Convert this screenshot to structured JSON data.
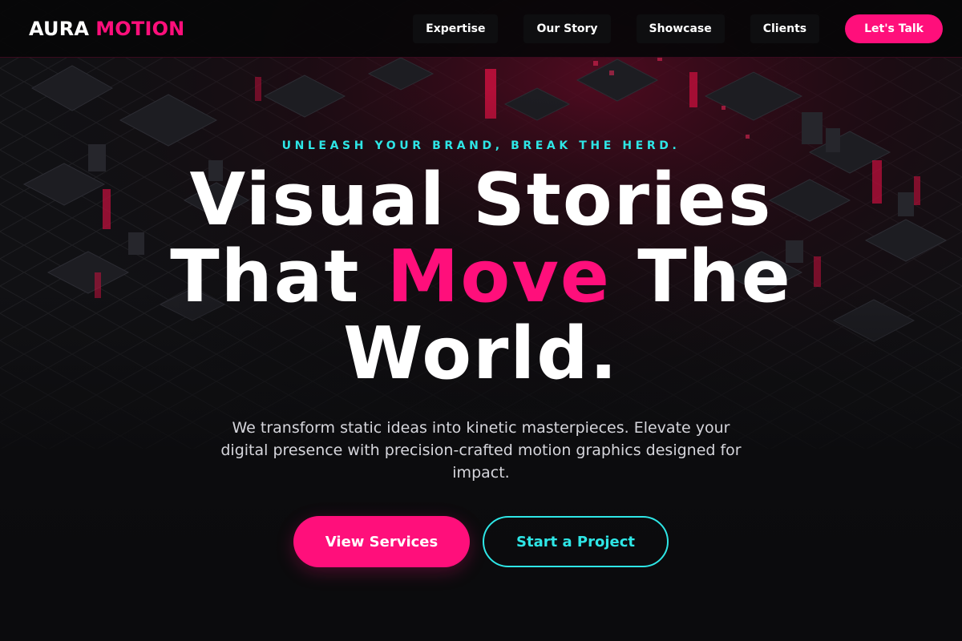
{
  "brand": {
    "word_1": "AURA",
    "word_2": "MOTION"
  },
  "nav": {
    "items": [
      {
        "label": "Expertise"
      },
      {
        "label": "Our Story"
      },
      {
        "label": "Showcase"
      },
      {
        "label": "Clients"
      }
    ],
    "cta_label": "Let's Talk"
  },
  "hero": {
    "eyebrow": "UNLEASH YOUR BRAND, BREAK THE HERD.",
    "headline": {
      "line_1": "Visual Stories",
      "line_2_start": "That ",
      "line_2_accent": "Move",
      "line_2_end": " The",
      "line_3": "World."
    },
    "lede": "We transform static ideas into kinetic masterpieces. Elevate your digital presence with precision-crafted motion graphics designed for impact.",
    "primary_button": "View Services",
    "secondary_button": "Start a Project"
  },
  "colors": {
    "accent_pink": "#ff0f7b",
    "accent_cyan": "#2ee6e6",
    "background": "#0b0b0d"
  },
  "background_art": "isometric-city-circuit-illustration"
}
